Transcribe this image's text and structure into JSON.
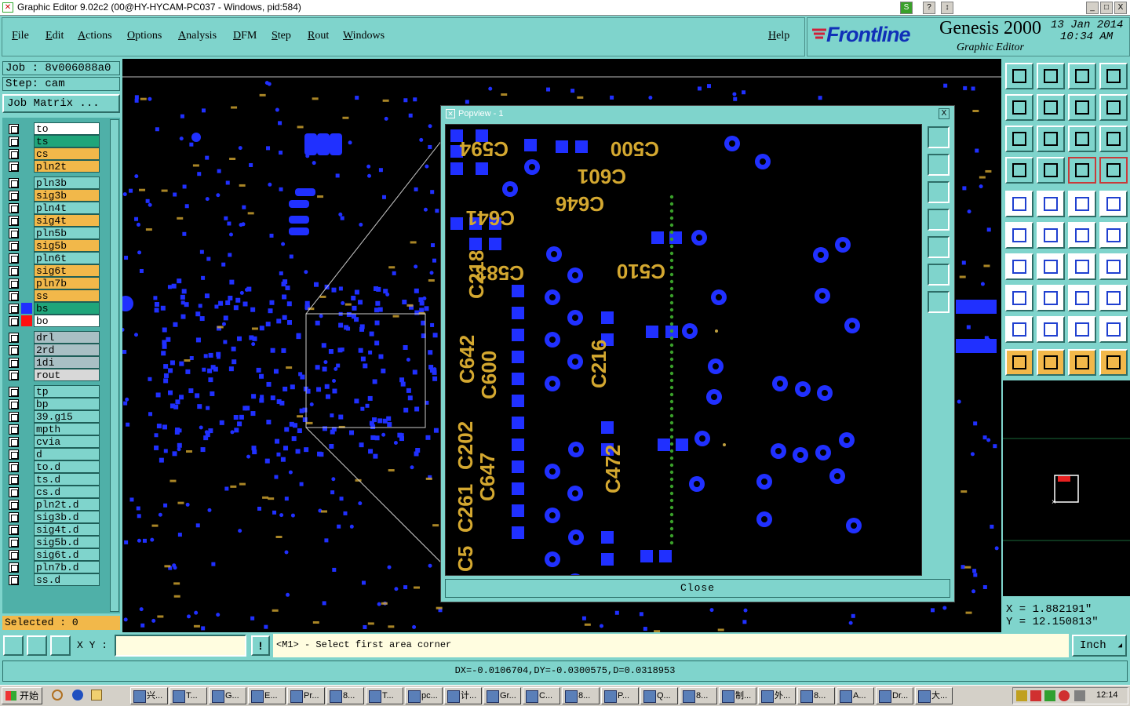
{
  "window": {
    "title": "Graphic Editor 9.02c2 (00@HY-HYCAM-PC037 - Windows, pid:584)",
    "min_label": "_",
    "max_label": "□",
    "close_label": "X",
    "help_q_label": "?"
  },
  "menu": {
    "items": [
      "File",
      "Edit",
      "Actions",
      "Options",
      "Analysis",
      "DFM",
      "Step",
      "Rout",
      "Windows"
    ],
    "help": "Help"
  },
  "brand": {
    "logo": "Frontline",
    "product": "Genesis 2000",
    "subtitle": "Graphic Editor",
    "date": "13 Jan 2014",
    "time": "10:34 AM"
  },
  "job": {
    "job_label": "Job : 8v006088a0",
    "step_label": "Step: cam",
    "matrix_button": "Job Matrix ..."
  },
  "layers": [
    {
      "name": "to",
      "color": "#ffffff",
      "mark": "◢",
      "swatch": ""
    },
    {
      "name": "ts",
      "color": "#1fa57a",
      "mark": "",
      "swatch": ""
    },
    {
      "name": "cs",
      "color": "#f2b84a",
      "mark": "◢",
      "swatch": ""
    },
    {
      "name": "pln2t",
      "color": "#f2b84a",
      "mark": "◢",
      "swatch": ""
    },
    {
      "name": "pln3b",
      "color": "#7fd4cc",
      "mark": "",
      "swatch": ""
    },
    {
      "name": "sig3b",
      "color": "#f2b84a",
      "mark": "",
      "swatch": ""
    },
    {
      "name": "pln4t",
      "color": "#7fd4cc",
      "mark": "",
      "swatch": ""
    },
    {
      "name": "sig4t",
      "color": "#f2b84a",
      "mark": "",
      "swatch": ""
    },
    {
      "name": "pln5b",
      "color": "#7fd4cc",
      "mark": "",
      "swatch": ""
    },
    {
      "name": "sig5b",
      "color": "#f2b84a",
      "mark": "",
      "swatch": ""
    },
    {
      "name": "pln6t",
      "color": "#7fd4cc",
      "mark": "",
      "swatch": ""
    },
    {
      "name": "sig6t",
      "color": "#f2b84a",
      "mark": "",
      "swatch": ""
    },
    {
      "name": "pln7b",
      "color": "#f2b84a",
      "mark": "◢",
      "swatch": ""
    },
    {
      "name": "ss",
      "color": "#f2b84a",
      "mark": "◢",
      "swatch": ""
    },
    {
      "name": "bs",
      "color": "#1fa57a",
      "mark": "",
      "swatch": "#2030ff"
    },
    {
      "name": "bo",
      "color": "#ffffff",
      "mark": "",
      "swatch": "#ff1010"
    },
    {
      "name": "drl",
      "color": "#a9bfc4",
      "mark": "",
      "swatch": ""
    },
    {
      "name": "2rd",
      "color": "#a9bfc4",
      "mark": "",
      "swatch": ""
    },
    {
      "name": "1di",
      "color": "#a9bfc4",
      "mark": "",
      "swatch": ""
    },
    {
      "name": "rout",
      "color": "#d8d8d8",
      "mark": "",
      "swatch": ""
    },
    {
      "name": "tp",
      "color": "#7fd4cc",
      "mark": "",
      "swatch": ""
    },
    {
      "name": "bp",
      "color": "#7fd4cc",
      "mark": "",
      "swatch": ""
    },
    {
      "name": "39.g15",
      "color": "#7fd4cc",
      "mark": "",
      "swatch": ""
    },
    {
      "name": "mpth",
      "color": "#7fd4cc",
      "mark": "",
      "swatch": ""
    },
    {
      "name": "cvia",
      "color": "#7fd4cc",
      "mark": "",
      "swatch": ""
    },
    {
      "name": "d",
      "color": "#7fd4cc",
      "mark": "",
      "swatch": ""
    },
    {
      "name": "to.d",
      "color": "#7fd4cc",
      "mark": "◢",
      "swatch": ""
    },
    {
      "name": "ts.d",
      "color": "#7fd4cc",
      "mark": "",
      "swatch": ""
    },
    {
      "name": "cs.d",
      "color": "#7fd4cc",
      "mark": "◢",
      "swatch": ""
    },
    {
      "name": "pln2t.d",
      "color": "#7fd4cc",
      "mark": "◢",
      "swatch": ""
    },
    {
      "name": "sig3b.d",
      "color": "#7fd4cc",
      "mark": "",
      "swatch": ""
    },
    {
      "name": "sig4t.d",
      "color": "#7fd4cc",
      "mark": "",
      "swatch": ""
    },
    {
      "name": "sig5b.d",
      "color": "#7fd4cc",
      "mark": "",
      "swatch": ""
    },
    {
      "name": "sig6t.d",
      "color": "#7fd4cc",
      "mark": "",
      "swatch": ""
    },
    {
      "name": "pln7b.d",
      "color": "#7fd4cc",
      "mark": "◢",
      "swatch": ""
    },
    {
      "name": "ss.d",
      "color": "#7fd4cc",
      "mark": "◢",
      "swatch": ""
    }
  ],
  "selected": "Selected : 0",
  "popview": {
    "title": "Popview - 1",
    "close_x": "X",
    "close_button": "Close",
    "labels": [
      "C594",
      "C500",
      "C601",
      "C646",
      "C641",
      "C583",
      "C510",
      "C218",
      "C642",
      "C600",
      "C216",
      "C202",
      "C647",
      "C261",
      "C472",
      "C5"
    ]
  },
  "coords": {
    "x": "X = 1.882191\"",
    "y": "Y = 12.150813\""
  },
  "status": {
    "xy_label": "X Y :",
    "xy_value": "",
    "info_icon": "!",
    "prompt": "<M1> - Select first area corner",
    "units": "Inch",
    "units_arrow": "◢",
    "dx": "DX=-0.0106704,DY=-0.0300575,D=0.0318953"
  },
  "taskbar": {
    "start": "开始",
    "clock": "12:14",
    "tasks": [
      "兴...",
      "T...",
      "G...",
      "E...",
      "Pr...",
      "8...",
      "T...",
      "pc...",
      "计...",
      "Gr...",
      "C...",
      "8...",
      "P...",
      "Q...",
      "8...",
      "制...",
      "外...",
      "8...",
      "A...",
      "Dr...",
      "大..."
    ]
  },
  "colors": {
    "panel": "#7fd4cc",
    "copper": "#2030ff",
    "silk": "#d4a830",
    "via_green": "#3aa02a"
  }
}
